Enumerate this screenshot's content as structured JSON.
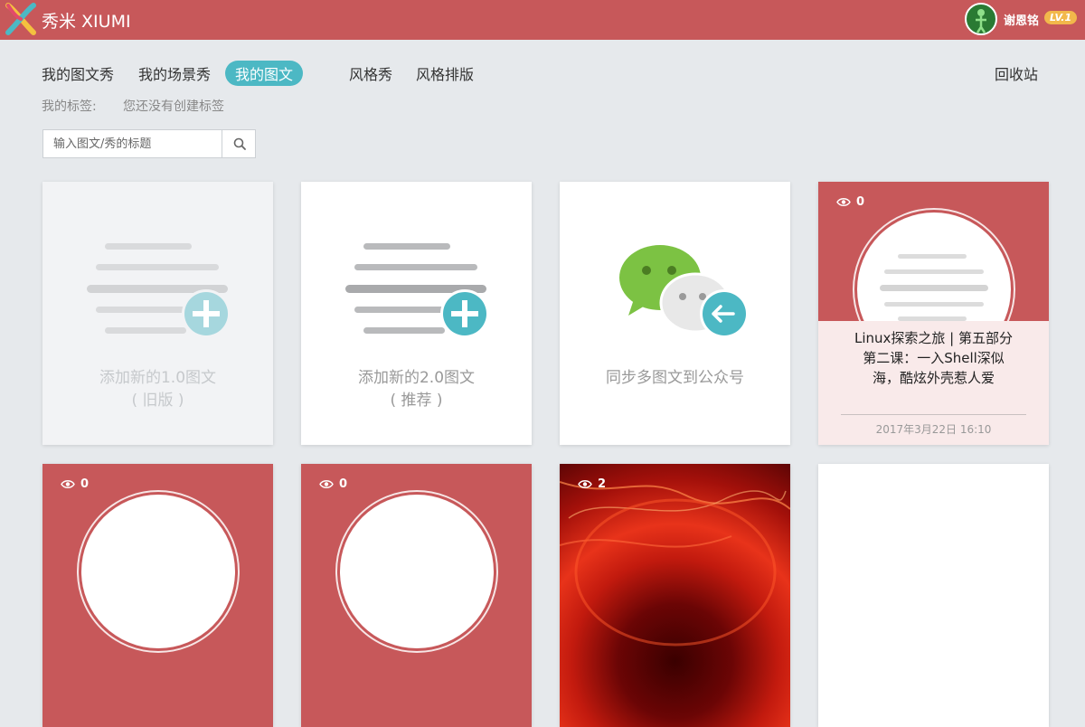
{
  "header": {
    "brand": "秀米 XIUMI",
    "username": "谢恩铭",
    "level": "LV.1"
  },
  "tabs": [
    {
      "label": "我的图文秀",
      "active": false
    },
    {
      "label": "我的场景秀",
      "active": false
    },
    {
      "label": "我的图文",
      "active": true
    },
    {
      "label": "风格秀",
      "active": false
    },
    {
      "label": "风格排版",
      "active": false
    }
  ],
  "recycle_label": "回收站",
  "tags": {
    "label": "我的标签:",
    "empty_text": "您还没有创建标签"
  },
  "search": {
    "placeholder": "输入图文/秀的标题",
    "value": ""
  },
  "cards": {
    "new_v1": {
      "line1": "添加新的1.0图文",
      "line2": "( 旧版 )"
    },
    "new_v2": {
      "line1": "添加新的2.0图文",
      "line2": "( 推荐 )"
    },
    "sync": {
      "label": "同步多图文到公众号"
    }
  },
  "articles": [
    {
      "views": "0",
      "title": "Linux探索之旅 | 第五部分第二课：一入Shell深似海，酷炫外壳惹人爱",
      "date": "2017年3月22日 16:10"
    },
    {
      "views": "0"
    },
    {
      "views": "0"
    },
    {
      "views": "2"
    }
  ],
  "colors": {
    "brand_red": "#c7585a",
    "accent_teal": "#4cb8c4",
    "level_badge": "#f2b84b"
  }
}
